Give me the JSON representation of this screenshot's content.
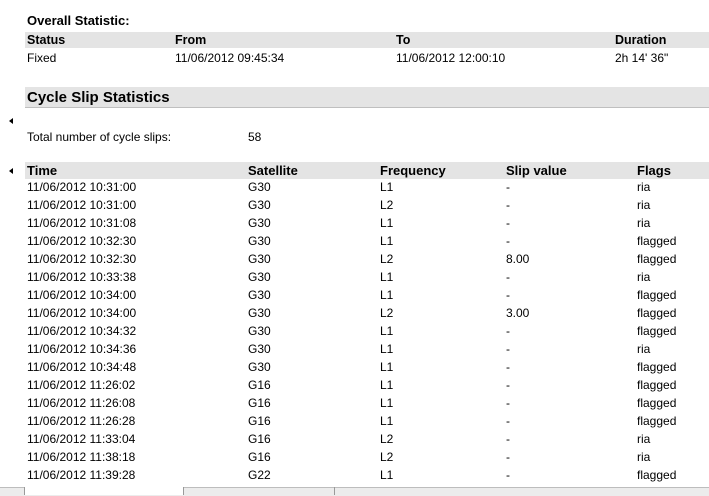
{
  "overall": {
    "title": "Overall Statistic:",
    "headers": {
      "status": "Status",
      "from": "From",
      "to": "To",
      "duration": "Duration"
    },
    "values": {
      "status": "Fixed",
      "from": "11/06/2012 09:45:34",
      "to": "11/06/2012 12:00:10",
      "duration": "2h 14' 36\""
    }
  },
  "cycle_slip": {
    "title": "Cycle Slip Statistics",
    "total_label": "Total number of cycle slips:",
    "total_value": "58",
    "columns": {
      "time": "Time",
      "satellite": "Satellite",
      "frequency": "Frequency",
      "slip_value": "Slip value",
      "flags": "Flags"
    },
    "rows": [
      {
        "time": "11/06/2012 10:31:00",
        "satellite": "G30",
        "frequency": "L1",
        "slip_value": "-",
        "flags": "ria"
      },
      {
        "time": "11/06/2012 10:31:00",
        "satellite": "G30",
        "frequency": "L2",
        "slip_value": "-",
        "flags": "ria"
      },
      {
        "time": "11/06/2012 10:31:08",
        "satellite": "G30",
        "frequency": "L1",
        "slip_value": "-",
        "flags": "ria"
      },
      {
        "time": "11/06/2012 10:32:30",
        "satellite": "G30",
        "frequency": "L1",
        "slip_value": "-",
        "flags": "flagged"
      },
      {
        "time": "11/06/2012 10:32:30",
        "satellite": "G30",
        "frequency": "L2",
        "slip_value": "8.00",
        "flags": "flagged"
      },
      {
        "time": "11/06/2012 10:33:38",
        "satellite": "G30",
        "frequency": "L1",
        "slip_value": "-",
        "flags": "ria"
      },
      {
        "time": "11/06/2012 10:34:00",
        "satellite": "G30",
        "frequency": "L1",
        "slip_value": "-",
        "flags": "flagged"
      },
      {
        "time": "11/06/2012 10:34:00",
        "satellite": "G30",
        "frequency": "L2",
        "slip_value": "3.00",
        "flags": "flagged"
      },
      {
        "time": "11/06/2012 10:34:32",
        "satellite": "G30",
        "frequency": "L1",
        "slip_value": "-",
        "flags": "flagged"
      },
      {
        "time": "11/06/2012 10:34:36",
        "satellite": "G30",
        "frequency": "L1",
        "slip_value": "-",
        "flags": "ria"
      },
      {
        "time": "11/06/2012 10:34:48",
        "satellite": "G30",
        "frequency": "L1",
        "slip_value": "-",
        "flags": "flagged"
      },
      {
        "time": "11/06/2012 11:26:02",
        "satellite": "G16",
        "frequency": "L1",
        "slip_value": "-",
        "flags": "flagged"
      },
      {
        "time": "11/06/2012 11:26:08",
        "satellite": "G16",
        "frequency": "L1",
        "slip_value": "-",
        "flags": "flagged"
      },
      {
        "time": "11/06/2012 11:26:28",
        "satellite": "G16",
        "frequency": "L1",
        "slip_value": "-",
        "flags": "flagged"
      },
      {
        "time": "11/06/2012 11:33:04",
        "satellite": "G16",
        "frequency": "L2",
        "slip_value": "-",
        "flags": "ria"
      },
      {
        "time": "11/06/2012 11:38:18",
        "satellite": "G16",
        "frequency": "L2",
        "slip_value": "-",
        "flags": "ria"
      },
      {
        "time": "11/06/2012 11:39:28",
        "satellite": "G22",
        "frequency": "L1",
        "slip_value": "-",
        "flags": "flagged"
      }
    ]
  }
}
